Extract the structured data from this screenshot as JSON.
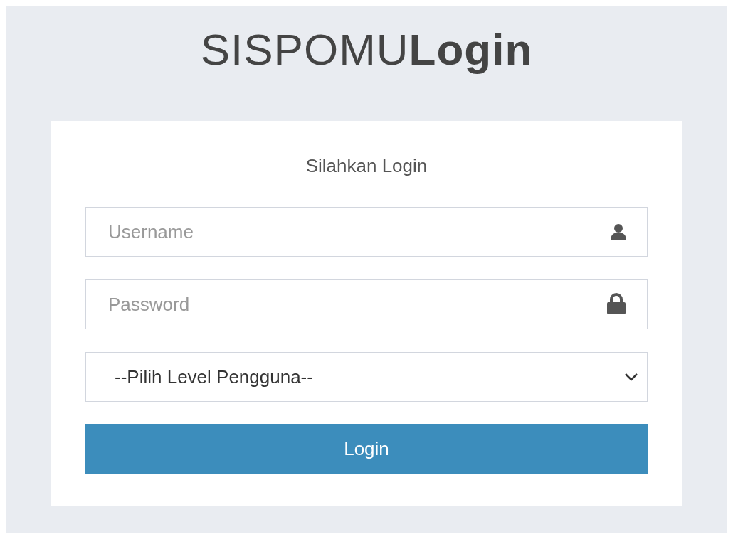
{
  "title": "SISPOMU**Login**",
  "box_message": "Silahkan Login",
  "username": {
    "placeholder": "Username"
  },
  "password": {
    "placeholder": "Password"
  },
  "level_select": {
    "value": "--Pilih Level Pengguna--"
  },
  "login_button": "Login"
}
